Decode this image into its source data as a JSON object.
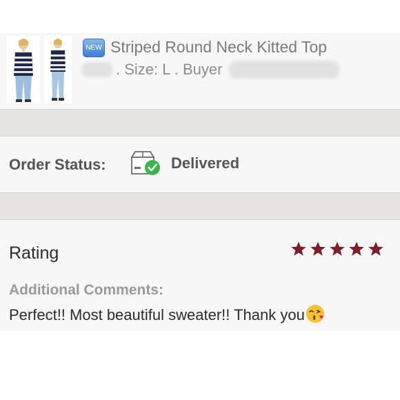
{
  "product": {
    "badge": "NEW",
    "title": "Striped Round Neck Kitted Top",
    "meta": ". Size: L . Buyer"
  },
  "order_status": {
    "label": "Order Status:",
    "value": "Delivered",
    "icon": "delivered-box-icon"
  },
  "rating": {
    "label": "Rating",
    "stars": 5,
    "max_stars": 5,
    "star_color": "#7a1f2b",
    "comments_label": "Additional Comments:",
    "comment": "Perfect!! Most beautiful sweater!! Thank you",
    "emoji": "kissing-face-emoji"
  },
  "colors": {
    "delivered_check": "#3bb54a",
    "new_badge": "#3b7cd2"
  }
}
